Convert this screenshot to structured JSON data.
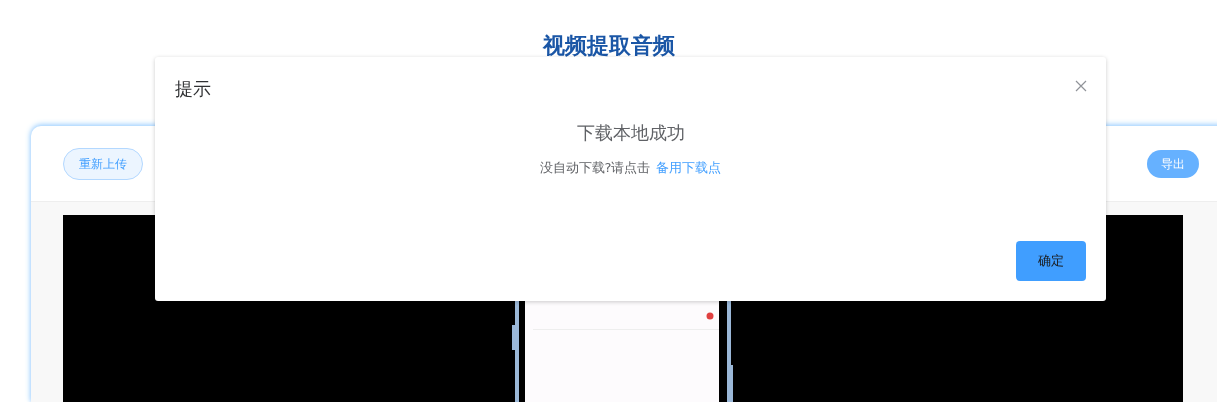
{
  "page_title": "视频提取音频",
  "toolbar": {
    "reupload_button": "重新上传",
    "export_button": "导出"
  },
  "dialog": {
    "title": "提示",
    "message": "下载本地成功",
    "hint": "没自动下载?请点击",
    "link": "备用下载点",
    "confirm_button": "确定"
  }
}
